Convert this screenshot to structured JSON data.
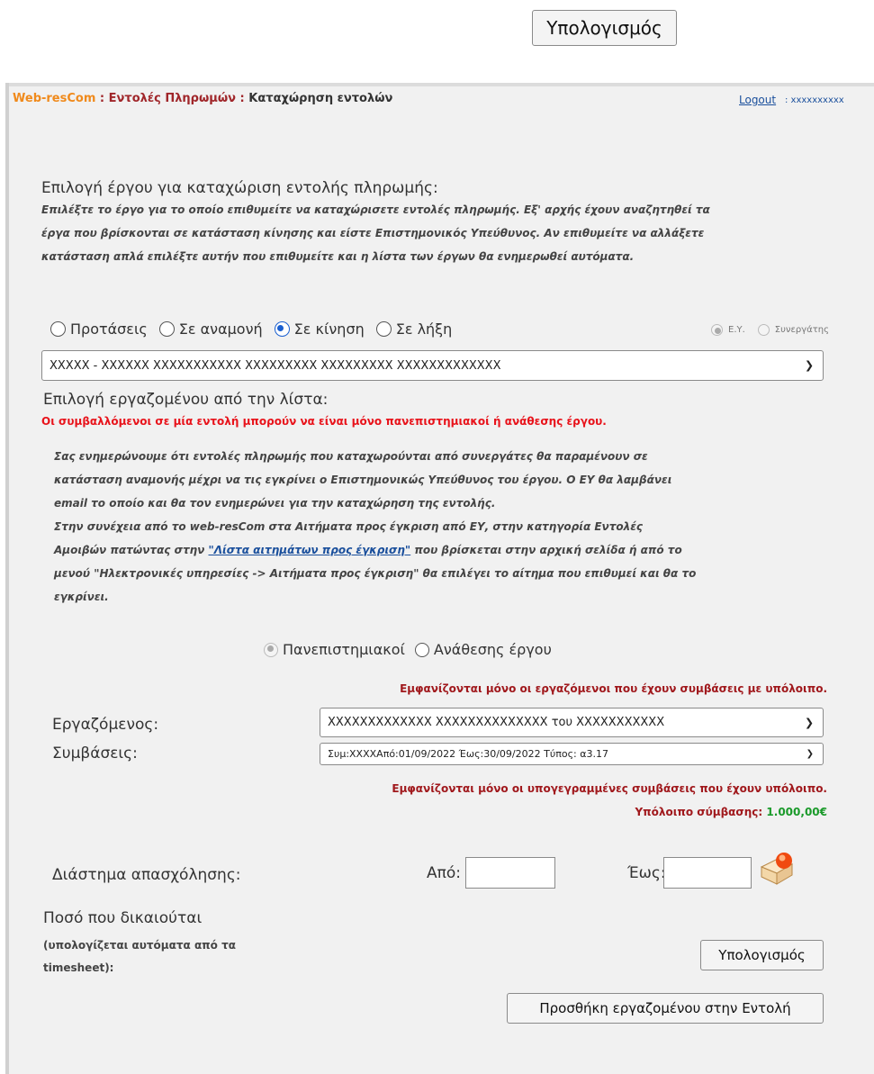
{
  "top": {
    "calc_button": "Υπολογισμός"
  },
  "header": {
    "brand": "Web-resCom",
    "separator": " : ",
    "section": "Εντολές Πληρωμών",
    "current": "Καταχώρηση εντολών",
    "logout": "Logout",
    "user": ": xxxxxxxxxx"
  },
  "project_select": {
    "title": "Επιλογή έργου για καταχώριση εντολής πληρωμής:",
    "help_lines": [
      "Επιλέξτε το έργο για το οποίο επιθυμείτε να καταχώρισετε εντολές πληρωμής. Εξ' αρχής έχουν αναζητηθεί τα",
      "έργα που βρίσκονται σε κατάσταση κίνησης και είστε Επιστημονικός Υπεύθυνος. Αν επιθυμείτε να αλλάξετε",
      "κατάσταση απλά επιλέξτε αυτήν που επιθυμείτε και η λίστα των έργων θα ενημερωθεί αυτόματα."
    ],
    "status_options": [
      {
        "label": "Προτάσεις",
        "selected": false
      },
      {
        "label": "Σε αναμονή",
        "selected": false
      },
      {
        "label": "Σε κίνηση",
        "selected": true
      },
      {
        "label": "Σε λήξη",
        "selected": false
      }
    ],
    "role_options": [
      {
        "label": "Ε.Υ.",
        "selected": true
      },
      {
        "label": "Συνεργάτης",
        "selected": false
      }
    ],
    "project_value": "XXXXX - XXXXXX XXXXXXXXXXX XXXXXXXXX XXXXXXXXX XXXXXXXXXXXXX"
  },
  "employee_select": {
    "title": "Επιλογή εργαζομένου από την λίστα:",
    "warning": "Οι συμβαλλόμενοι σε μία εντολή μπορούν να είναι μόνο πανεπιστημιακοί ή ανάθεσης έργου.",
    "info_lines": [
      "Σας ενημερώνουμε ότι εντολές πληρωμής που καταχωρούνται από συνεργάτες θα παραμένουν σε",
      "κατάσταση αναμονής μέχρι να τις εγκρίνει ο Επιστημονικώς Υπεύθυνος του έργου. Ο ΕΥ θα λαμβάνει",
      "email το οποίο και θα τον ενημερώνει για την καταχώρηση της εντολής."
    ],
    "flow_line1": "Στην συνέχεια από το web-resCom στα Αιτήματα προς έγκριση από ΕΥ, στην κατηγορία Εντολές",
    "flow_line2_pre": "Αμοιβών πατώντας στην ",
    "flow_link": "\"Λίστα αιτημάτων προς έγκριση\"",
    "flow_line2_post": " που βρίσκεται στην αρχική σελίδα ή από το",
    "flow_line3": "μενού \"Ηλεκτρονικές υπηρεσίες -> Αιτήματα προς έγκριση\" θα επιλέγει το αίτημα που επιθυμεί και θα το",
    "flow_line4": "εγκρίνει.",
    "type_options": [
      {
        "label": "Πανεπιστημιακοί",
        "selected": true
      },
      {
        "label": "Ανάθεσης έργου",
        "selected": false
      }
    ],
    "note_balance": "Εμφανίζονται μόνο οι εργαζόμενοι που έχουν συμβάσεις με υπόλοιπο.",
    "employee_label": "Εργαζόμενος:",
    "employee_value": "XXXXXXXXXXXXX XXXXXXXXXXXXXX του XXXXXXXXXXX",
    "contracts_label": "Συμβάσεις:",
    "contract_value_a": "Συμ:XXXX",
    "contract_value_b": "Από:01/09/2022 Έως:30/09/2022 Τύπος: α3.17",
    "note_signed": "Εμφανίζονται μόνο οι υπογεγραμμένες συμβάσεις που έχουν υπόλοιπο.",
    "balance_label": "Υπόλοιπο σύμβασης:",
    "balance_value": "1.000,00€"
  },
  "period": {
    "label": "Διάστημα απασχόλησης:",
    "from_label": "Από:",
    "to_label": "Έως:"
  },
  "amount": {
    "label": "Ποσό που δικαιούται",
    "sublabel1": "(υπολογίζεται αυτόματα από τα",
    "sublabel2": "timesheet):",
    "calc_button": "Υπολογισμός"
  },
  "add_button": "Προσθήκη εργαζομένου στην Εντολή",
  "colors": {
    "brand": "#f08a1c",
    "link": "#1a4f9c",
    "warning_red": "#e8131b",
    "dark_red": "#a0181c",
    "balance_green": "#1a9a2a"
  }
}
